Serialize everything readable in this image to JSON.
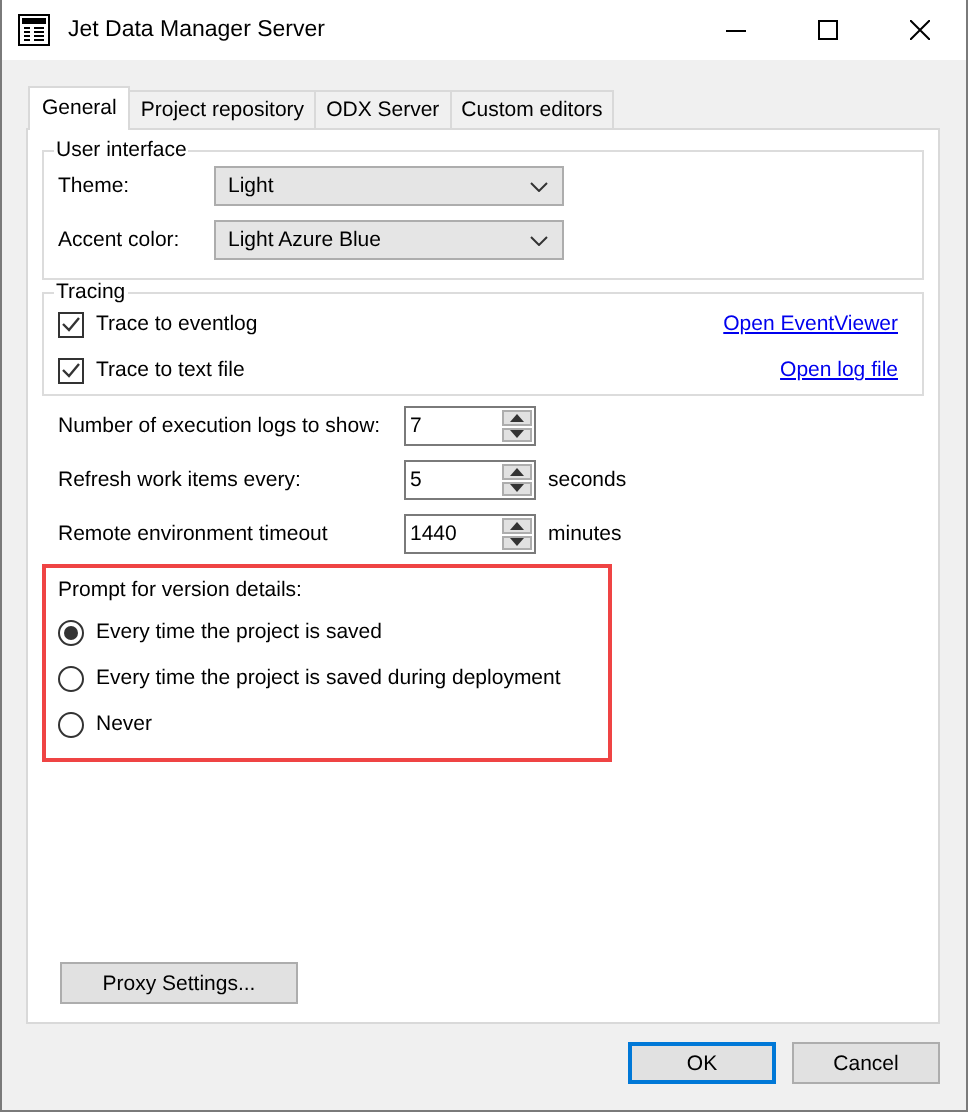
{
  "window": {
    "title": "Jet Data Manager Server"
  },
  "tabs": [
    {
      "label": "General",
      "selected": true
    },
    {
      "label": "Project repository",
      "selected": false
    },
    {
      "label": "ODX Server",
      "selected": false
    },
    {
      "label": "Custom editors",
      "selected": false
    }
  ],
  "user_interface": {
    "legend": "User interface",
    "fields": [
      {
        "label": "Theme:",
        "value": "Light"
      },
      {
        "label": "Accent color:",
        "value": "Light Azure Blue"
      }
    ]
  },
  "tracing": {
    "legend": "Tracing",
    "items": [
      {
        "label": "Trace to eventlog",
        "checked": true,
        "link": "Open EventViewer"
      },
      {
        "label": "Trace to text file",
        "checked": true,
        "link": "Open log file"
      }
    ]
  },
  "settings": [
    {
      "label": "Number of execution logs to show:",
      "value": "7"
    },
    {
      "label": "Refresh work items every:",
      "value": "5",
      "unit": "seconds"
    },
    {
      "label": "Remote environment timeout",
      "value": "1440",
      "unit": "minutes"
    }
  ],
  "version_prompt": {
    "label": "Prompt for version details:",
    "options": [
      {
        "label": "Every time the project is saved",
        "selected": true
      },
      {
        "label": "Every time the project is saved during deployment",
        "selected": false
      },
      {
        "label": "Never",
        "selected": false
      }
    ]
  },
  "proxy_button": "Proxy Settings...",
  "buttons": [
    {
      "label": "OK",
      "default": true
    },
    {
      "label": "Cancel",
      "default": false
    }
  ]
}
